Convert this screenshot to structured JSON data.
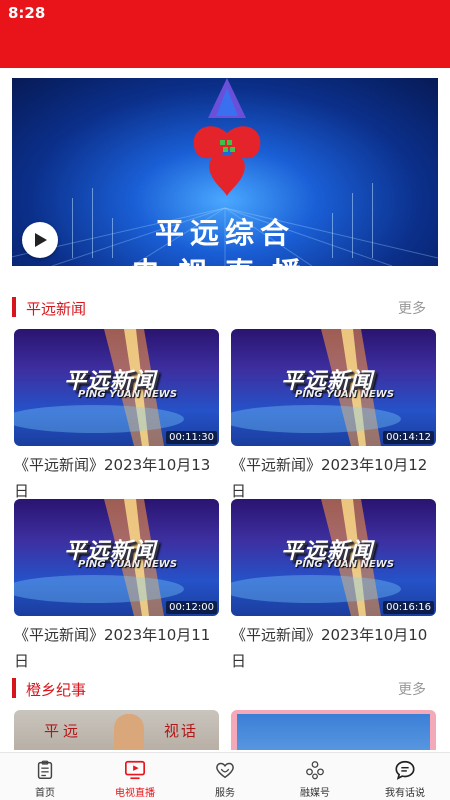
{
  "status_bar": {
    "time": "8:28",
    "color": "#e8141a"
  },
  "live_banner": {
    "title": "平远综合",
    "subtitle": "电视直播"
  },
  "sections": [
    {
      "title": "平远新闻",
      "more_label": "更多"
    },
    {
      "title": "橙乡纪事",
      "more_label": "更多"
    }
  ],
  "videos": [
    {
      "title": "《平远新闻》2023年10月13日",
      "duration": "00:11:30",
      "logo_text": "平远新闻",
      "logo_sub": "PING YUAN NEWS"
    },
    {
      "title": "《平远新闻》2023年10月12日",
      "duration": "00:14:12",
      "logo_text": "平远新闻",
      "logo_sub": "PING YUAN NEWS"
    },
    {
      "title": "《平远新闻》2023年10月11日",
      "duration": "00:12:00",
      "logo_text": "平远新闻",
      "logo_sub": "PING YUAN NEWS"
    },
    {
      "title": "《平远新闻》2023年10月10日",
      "duration": "00:16:16",
      "logo_text": "平远新闻",
      "logo_sub": "PING YUAN NEWS"
    }
  ],
  "peek_thumb": {
    "text_left": "平远",
    "text_right": "视话"
  },
  "tabs": [
    {
      "label": "首页",
      "icon": "clipboard-icon",
      "active": false
    },
    {
      "label": "电视直播",
      "icon": "tv-play-icon",
      "active": true
    },
    {
      "label": "服务",
      "icon": "heart-icon",
      "active": false
    },
    {
      "label": "融媒号",
      "icon": "media-circles-icon",
      "active": false
    },
    {
      "label": "我有话说",
      "icon": "chat-bubble-icon",
      "active": false
    }
  ],
  "colors": {
    "accent": "#e8141a",
    "section_red": "#d7151c",
    "muted": "#999999"
  }
}
